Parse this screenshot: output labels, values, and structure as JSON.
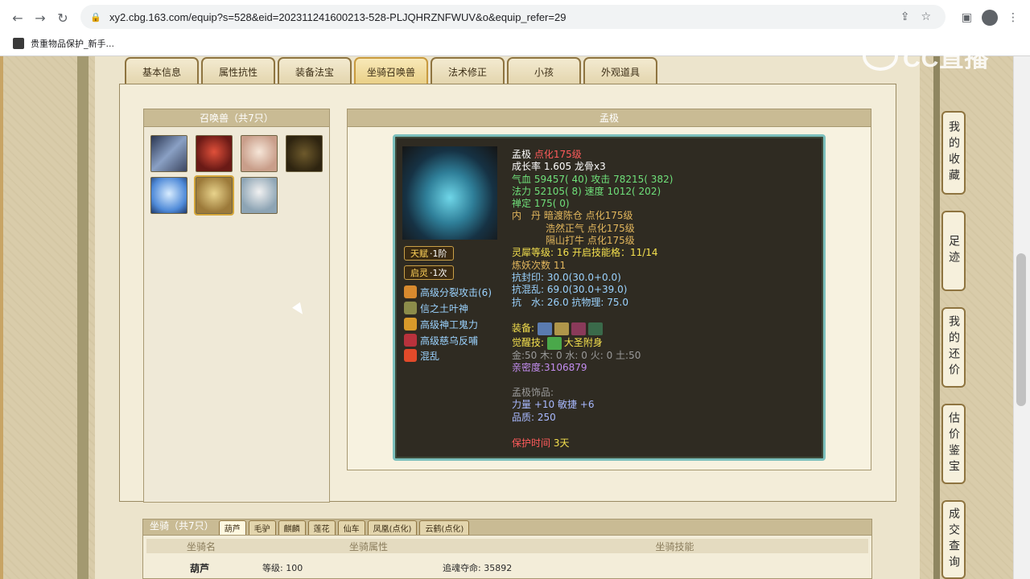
{
  "browser": {
    "url": "xy2.cbg.163.com/equip?s=528&eid=202311241600213-528-PLJQHRZNFWUV&o&equip_refer=29",
    "bookmark_label": "贵重物品保护_新手...",
    "watermark": "CC直播"
  },
  "tabs": [
    {
      "label": "基本信息"
    },
    {
      "label": "属性抗性"
    },
    {
      "label": "装备法宝"
    },
    {
      "label": "坐骑召唤兽"
    },
    {
      "label": "法术修正"
    },
    {
      "label": "小孩"
    },
    {
      "label": "外观道具"
    }
  ],
  "pet_list": {
    "header": "召唤兽（共7只）",
    "colors": [
      "#4a5c7a",
      "#a3322a",
      "#e8d3c0",
      "#5c4a24",
      "#8fbfff",
      "#c6a66a",
      "#b8c8d6"
    ]
  },
  "detail": {
    "header": "孟极",
    "badges": [
      {
        "label": "天赋",
        "sub": "·1阶"
      },
      {
        "label": "启灵",
        "sub": "·1次"
      }
    ],
    "skills": [
      {
        "name": "高级分裂攻击(6)",
        "color": "#d88a2e"
      },
      {
        "name": "信之土叶神",
        "color": "#8c8c4a"
      },
      {
        "name": "高级神工鬼力",
        "color": "#d99a2a"
      },
      {
        "name": "高级慈乌反哺",
        "color": "#b8323c"
      },
      {
        "name": "混乱",
        "color": "#e24a2a"
      }
    ],
    "stats": {
      "name": "孟极",
      "name_level": "点化175级",
      "growth": "成长率 1.605 龙骨x3",
      "hp_label": "气血",
      "hp_value": "59457( 40)",
      "atk_label": "攻击",
      "atk_value": "78215( 382)",
      "mp_label": "法力",
      "mp_value": "52105( 8)",
      "spd_label": "速度",
      "spd_value": "1012( 202)",
      "zen_label": "禅定",
      "zen_value": "175( 0)",
      "dan1": "内　丹 暗渡陈仓 点化175级",
      "dan2": "浩然正气 点化175级",
      "dan3": "隔山打牛 点化175级",
      "spirit_label": "灵犀等级:",
      "spirit_value": "16 开启技能格：11/14",
      "refine": "炼妖次数 11",
      "seal": "抗封印: 30.0(30.0+0.0)",
      "chaos": "抗混乱: 69.0(30.0+39.0)",
      "water_label": "抗　水: 26.0",
      "phys_label": "抗物理: 75.0",
      "equip_label": "装备:",
      "awaken_label": "觉醒技:",
      "awaken_value": "大圣附身",
      "elements": "金:50 木: 0 水: 0 火: 0 土:50",
      "intimacy": "亲密度:3106879",
      "acc_title": "孟极饰品:",
      "acc_stats": "力量 +10 敏捷 +6",
      "acc_quality": "品质: 250",
      "protect_label": "保护时间",
      "protect_value": "3天"
    }
  },
  "mount": {
    "header": "坐骑（共7只）",
    "tabs": [
      "葫芦",
      "毛驴",
      "麒麟",
      "莲花",
      "仙车",
      "凤凰(点化)",
      "云鹤(点化)"
    ],
    "col_name": "坐骑名",
    "col_attr": "坐骑属性",
    "col_skill": "坐骑技能",
    "row_name": "葫芦",
    "row_level": "等级: 100",
    "row_skill": "追魂夺命: 35892"
  },
  "sidebar": [
    {
      "label": "我的收藏"
    },
    {
      "label": "足迹"
    },
    {
      "label": "我的还价"
    },
    {
      "label": "估价鉴宝"
    },
    {
      "label": "成交查询"
    }
  ]
}
